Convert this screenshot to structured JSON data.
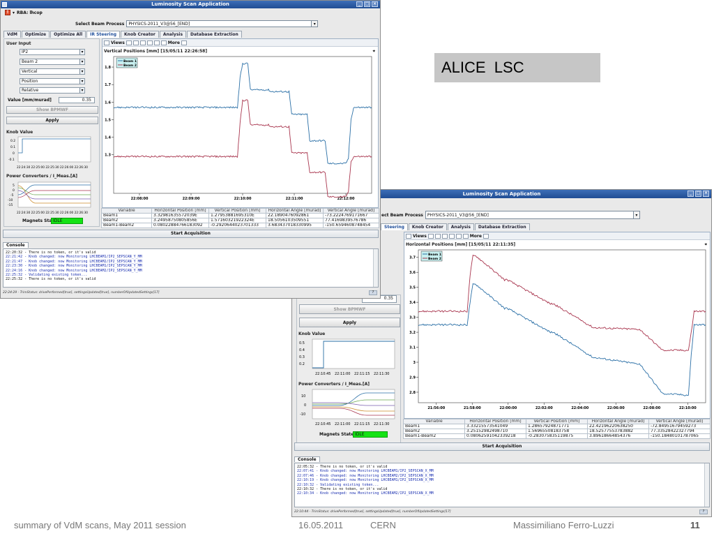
{
  "slide": {
    "callout": "ALICE  LSC",
    "footer_left": "summary of VdM scans, May 2011 session",
    "footer_date": "16.05.2011",
    "footer_org": "CERN",
    "footer_author": "Massimiliano Ferro-Luzzi",
    "page_number": "11"
  },
  "colors": {
    "beam1": "#2a6fa6",
    "beam2": "#a8344d",
    "titlebar": "#2c5aa0",
    "idle_state": "#14e214"
  },
  "icons": [
    "app-icon",
    "rba-icon",
    "minimize-icon",
    "maximize-icon",
    "close-icon",
    "chevron-down-icon",
    "views-icon",
    "layout-icons",
    "more-icon",
    "print-icon",
    "pin-icon",
    "scroll-arrow-icon"
  ],
  "window1": {
    "title": "Luminosity Scan Application",
    "rba_label": "RBA: lhcop",
    "beam_process_label": "Select Beam Process",
    "beam_process_value": "PHYSICS-2011_V3@56_[END]",
    "tabs": [
      "VdM",
      "Optimize",
      "Optimize All",
      "IR Steering",
      "Knob Creator",
      "Analysis",
      "Database Extraction"
    ],
    "active_tab": "IR Steering",
    "user_input": {
      "title": "User Input",
      "ip": "IP2",
      "beam": "Beam 2",
      "plane": "Vertical",
      "mode": "Position",
      "reference": "Relative",
      "value_label": "Value [mm/murad]",
      "value": "0.35",
      "show_button": "Show BPMWF",
      "apply_button": "Apply"
    },
    "knob_value": {
      "title": "Knob Value",
      "yticks": [
        "0.2",
        "0.1",
        "0",
        "-0.1"
      ],
      "xticks": "22:24:30 22:25:00 22:25:30 22:26:00 22:26:30"
    },
    "power_converters": {
      "title": "Power Converters / I_Meas.[A]",
      "yticks": [
        "5",
        "0",
        "-5",
        "-10",
        "-15"
      ],
      "xticks": "22:24:30 22:25:00 22:25:30 22:26:00 22:26:30"
    },
    "magnets_state_label": "Magnets State",
    "magnets_state_value": "IDLE",
    "plot_toolbar": {
      "views": "Views",
      "more": "More"
    },
    "plot_title": "Vertical Positions [mm]  [15/05/11 22:26:58]",
    "table": {
      "headers": [
        "Variable",
        "Horizontal Position [mm]",
        "Vertical Position [mm]",
        "Horizontal Angle [murad]",
        "Vertical Angle [murad]"
      ],
      "rows": [
        [
          "Beam1",
          "3.32981635572039E",
          "1.27953881695310E",
          "22.1890476092861",
          "-73.2224769171667"
        ],
        [
          "Beam2",
          "3.24958750805856E",
          "1.57160321922324E",
          "18.5056103509551",
          "77.4169839576786"
        ],
        [
          "Beam1-Beam2",
          "0.08022884766183092",
          "-0.2920644023701333",
          "3.683437018330995",
          "-150.6594608748454"
        ]
      ]
    },
    "start_button": "Start Acquisition",
    "console_tab": "Console",
    "console_lines": [
      "22:20:32 - There is no token, or it's valid",
      "22:21:42 - Knob changed: now Monitoring LHCBEAM1/IP2_SEPSCAN_Y_MM",
      "22:21:47 - Knob changed: now Monitoring LHCBEAM2/IP2_SEPSCAN_Y_MM",
      "22:23:30 - Knob changed: now Monitoring LHCBEAM1/IP2_SEPSCAN_Y_MM",
      "22:24:16 - Knob changed: now Monitoring LHCBEAM2/IP2_SEPSCAN_Y_MM",
      "22:25:32 - Validating existing token...",
      "22:25:32 - There is no token, or it's valid"
    ],
    "status": "22:24:29 - TrimStatus: drivePerformed[true], settingsUpdated[true], numberOfUpdatedSettings[17]"
  },
  "window2": {
    "title": "Luminosity Scan Application",
    "beam_process_label": "ect Beam Process",
    "beam_process_value": "PHYSICS-2011_V3@56_[END]",
    "tabs": [
      "Steering",
      "Knob Creator",
      "Analysis",
      "Database Extraction"
    ],
    "active_tab": "Steering",
    "value_label": "Value [mm/murad]",
    "value": "0.35",
    "show_button": "Show BPMWF",
    "apply_button": "Apply",
    "knob_value": {
      "title": "Knob Value",
      "yticks": [
        "0.5",
        "0.4",
        "0.3",
        "0.2"
      ],
      "xticks": [
        "22:10:45",
        "22:11:00",
        "22:11:15",
        "22:11:30"
      ]
    },
    "power_converters": {
      "title": "Power Converters / I_Meas.[A]",
      "yticks": [
        "10",
        "0",
        "-10"
      ],
      "xticks": [
        "22:10:45",
        "22:11:00",
        "22:11:15",
        "22:11:30"
      ]
    },
    "magnets_state_label": "Magnets State",
    "magnets_state_value": "IDLE",
    "plot_toolbar": {
      "views": "Views",
      "more": "More"
    },
    "plot_title": "Horizontal Positions [mm]  [15/05/11 22:11:35]",
    "table": {
      "headers": [
        "Variable",
        "Horizontal Position [mm]",
        "Vertical Position [mm]",
        "Horizontal Angle [murad]",
        "Vertical Angle [murad]"
      ],
      "rows": [
        [
          "Beam1",
          "3.33215573541049",
          "1.28657924871771",
          "22.42196220638250",
          "-72.84951679459273"
        ],
        [
          "Beam2",
          "3.25152982498710",
          "1.56965508183758",
          "18.52577553783882",
          "77.33528422327794"
        ],
        [
          "Beam1-Beam2",
          "0.08062591042339218",
          "-0.283075835119875",
          "3.89618664854376",
          "-150.18480101787065"
        ]
      ]
    },
    "start_button": "Start Acquisition",
    "console_tab": "Console",
    "console_lines": [
      "22:05:32 - There is no token, or it's valid",
      "22:07:41 - Knob changed: now Monitoring LHCBEAM1/IP2_SEPSCAN_X_MM",
      "22:07:46 - Knob changed: now Monitoring LHCBEAM2/IP2_SEPSCAN_X_MM",
      "22:10:19 - Knob changed: now Monitoring LHCBEAM1/IP2_SEPSCAN_X_MM",
      "22:10:32 - Validating existing token...",
      "22:10:32 - There is no token, or it's valid",
      "22:10:34 - Knob changed: now Monitoring LHCBEAM2/IP2_SEPSCAN_X_MM"
    ],
    "status": "22:10:44 - TrimStatus: drivePerformed[true], settingsUpdated[true], numberOfUpdatedSettings[17]"
  },
  "chart_data": [
    {
      "type": "line",
      "title": "Vertical Positions [mm]  [15/05/11 22:26:58]",
      "xlabel": "",
      "ylabel": "",
      "xticks": [
        "22:08:00",
        "22:09:00",
        "22:10:00",
        "22:11:00",
        "22:12:00"
      ],
      "yticks": [
        1.3,
        1.4,
        1.5,
        1.6,
        1.7,
        1.8
      ],
      "ylim": [
        1.08,
        1.86
      ],
      "xlim": [
        0,
        100
      ],
      "legend": "top-left",
      "grid": false,
      "series": [
        {
          "name": "Beam 1",
          "color": "#2a6fa6",
          "x": [
            0,
            48,
            49,
            50,
            52,
            53,
            60,
            61,
            68,
            69,
            75,
            76,
            82,
            83,
            90,
            91,
            92,
            93,
            100
          ],
          "y": [
            1.57,
            1.57,
            1.74,
            1.82,
            1.82,
            1.67,
            1.67,
            1.66,
            1.66,
            1.53,
            1.53,
            1.38,
            1.38,
            1.25,
            1.25,
            1.28,
            1.5,
            1.57,
            1.57
          ]
        },
        {
          "name": "Beam 2",
          "color": "#a8344d",
          "x": [
            0,
            48,
            49,
            50,
            52,
            53,
            60,
            61,
            68,
            69,
            75,
            76,
            82,
            83,
            90,
            91,
            92,
            93,
            100
          ],
          "y": [
            1.29,
            1.29,
            1.48,
            1.61,
            1.61,
            1.47,
            1.47,
            1.46,
            1.46,
            1.31,
            1.31,
            1.2,
            1.2,
            1.06,
            1.06,
            1.09,
            1.26,
            1.29,
            1.29
          ]
        }
      ]
    },
    {
      "type": "line",
      "title": "Horizontal Positions [mm]  [15/05/11 22:11:35]",
      "xlabel": "",
      "ylabel": "",
      "xticks": [
        "21:56:00",
        "21:58:00",
        "22:00:00",
        "22:02:00",
        "22:04:00",
        "22:06:00",
        "22:08:00",
        "22:10:00"
      ],
      "yticks": [
        2.8,
        2.9,
        3,
        3.1,
        3.2,
        3.3,
        3.4,
        3.5,
        3.6,
        3.7
      ],
      "ylim": [
        2.73,
        3.75
      ],
      "xlim": [
        0,
        100
      ],
      "legend": "top-left",
      "grid": false,
      "series": [
        {
          "name": "Beam 1",
          "color": "#2a6fa6",
          "x": [
            0,
            17,
            18,
            19,
            20,
            30,
            31,
            46,
            47,
            61,
            62,
            76,
            77,
            85,
            86,
            94,
            95,
            96,
            100
          ],
          "y": [
            3.25,
            3.25,
            3.4,
            3.52,
            3.52,
            3.36,
            3.36,
            3.2,
            3.2,
            3.03,
            3.03,
            2.99,
            2.99,
            2.79,
            2.79,
            2.78,
            3.05,
            3.25,
            3.25
          ]
        },
        {
          "name": "Beam 2",
          "color": "#a8344d",
          "x": [
            0,
            17,
            18,
            19,
            20,
            30,
            31,
            46,
            47,
            61,
            62,
            76,
            77,
            85,
            86,
            94,
            95,
            96,
            100
          ],
          "y": [
            3.34,
            3.34,
            3.58,
            3.71,
            3.71,
            3.55,
            3.55,
            3.39,
            3.39,
            3.23,
            3.23,
            3.22,
            3.22,
            3.08,
            3.08,
            3.08,
            3.2,
            3.34,
            3.34
          ]
        }
      ]
    }
  ]
}
